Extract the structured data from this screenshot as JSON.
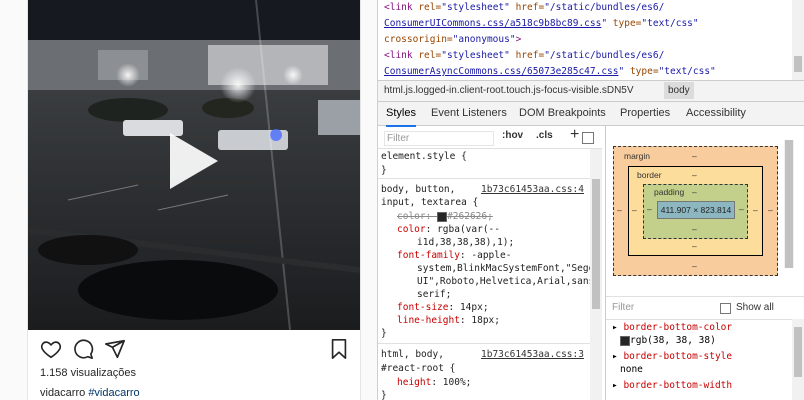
{
  "instagram": {
    "likes": "1.158 visualizações",
    "username": "vidacarro",
    "hashtag": "#vidacarro"
  },
  "source": {
    "rows": [
      {
        "tag_open": "<link ",
        "a1": "rel=",
        "v1": "\"stylesheet\"",
        "a2": " href=",
        "v2": "\"/static/bundles/es6/",
        "rest": ""
      },
      {
        "link": "ConsumerUICommons.css/a518c9b8bc89.css",
        "q": "\"",
        "a3": " type=",
        "v3": "\"text/css\""
      },
      {
        "a4": "crossorigin=",
        "v4": "\"anonymous\"",
        "close": ">"
      },
      {
        "tag_open": "<link ",
        "a1": "rel=",
        "v1": "\"stylesheet\"",
        "a2": " href=",
        "v2": "\"/static/bundles/es6/",
        "rest": ""
      },
      {
        "link": "ConsumerAsyncCommons.css/65073e285c47.css",
        "q": "\"",
        "a3": " type=",
        "v3": "\"text/css\""
      }
    ]
  },
  "breadcrumbs": {
    "path": "html.js.logged-in.client-root.touch.js-focus-visible.sDN5V",
    "current": "body"
  },
  "tabs": [
    "Styles",
    "Event Listeners",
    "DOM Breakpoints",
    "Properties",
    "Accessibility"
  ],
  "styles_toolbar": {
    "filter_placeholder": "Filter",
    "hov": ":hov",
    "cls": ".cls",
    "plus": "+"
  },
  "rules": {
    "element_style": "element.style {",
    "close": "}",
    "r1_sel1": "body, button,",
    "r1_file": "1b73c61453aa.css:4",
    "r1_sel2": "input, textarea {",
    "r1_p1": "color",
    "r1_v1": "#262626;",
    "r1_p2": "color",
    "r1_v2a": "rgba(var(--",
    "r1_v2b": "i1d,38,38,38),1);",
    "r1_p3": "font-family",
    "r1_v3a": "-apple-",
    "r1_v3b": "system,BlinkMacSystemFont,\"Segoe",
    "r1_v3c": "UI\",Roboto,Helvetica,Arial,sans-",
    "r1_v3d": "serif;",
    "r1_p4": "font-size",
    "r1_v4": "14px;",
    "r1_p5": "line-height",
    "r1_v5": "18px;",
    "r2_sel1": "html, body,",
    "r2_file": "1b73c61453aa.css:3",
    "r2_sel2": "#react-root {",
    "r2_p1": "height",
    "r2_v1": "100%;"
  },
  "boxmodel": {
    "margin_label": "margin",
    "border_label": "border",
    "padding_label": "padding",
    "dash": "–",
    "content": "411.907 × 823.814"
  },
  "computed": {
    "filter_placeholder": "Filter",
    "show_all": "Show all",
    "items": [
      {
        "name": "border-bottom-color",
        "value": "rgb(38, 38, 38)"
      },
      {
        "name": "border-bottom-style",
        "value": "none"
      },
      {
        "name": "border-bottom-width",
        "value": ""
      }
    ]
  }
}
